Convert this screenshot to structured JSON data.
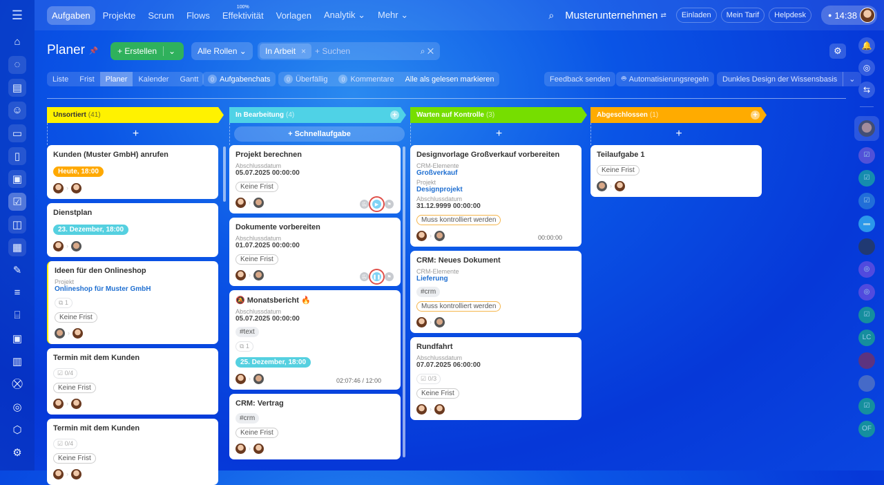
{
  "nav": {
    "items": [
      {
        "label": "Aufgaben",
        "active": true
      },
      {
        "label": "Projekte"
      },
      {
        "label": "Scrum"
      },
      {
        "label": "Flows"
      },
      {
        "label": "Effektivität",
        "sup": "100%"
      },
      {
        "label": "Vorlagen"
      },
      {
        "label": "Analytik ⌄"
      },
      {
        "label": "Mehr ⌄"
      }
    ]
  },
  "header": {
    "company": "Musterunternehmen",
    "invite": "Einladen",
    "tariff": "Mein Tarif",
    "helpdesk": "Helpdesk",
    "time": "14:38"
  },
  "left_sidebar": [
    {
      "icon": "home-icon",
      "g": "⌂"
    },
    {
      "icon": "feed-icon",
      "g": "◌"
    },
    {
      "icon": "docs-icon",
      "g": "▤"
    },
    {
      "icon": "contacts-icon",
      "g": "☺"
    },
    {
      "icon": "drive-icon",
      "g": "▭"
    },
    {
      "icon": "document-icon",
      "g": "▯"
    },
    {
      "icon": "board-icon",
      "g": "▣"
    },
    {
      "icon": "tasks-icon",
      "g": "☑"
    },
    {
      "icon": "chat-icon",
      "g": "◫"
    },
    {
      "icon": "calendar-icon",
      "g": "▦"
    },
    {
      "icon": "sign-icon",
      "g": "✎"
    },
    {
      "icon": "filter-icon",
      "g": "≡"
    },
    {
      "icon": "store-icon",
      "g": "⌸"
    },
    {
      "icon": "contact-center-icon",
      "g": "▣"
    },
    {
      "icon": "analytics-icon",
      "g": "▥"
    },
    {
      "icon": "cart-icon",
      "g": "⛒"
    },
    {
      "icon": "target-icon",
      "g": "◎"
    },
    {
      "icon": "package-icon",
      "g": "⬡"
    },
    {
      "icon": "settings-icon",
      "g": "⚙"
    }
  ],
  "page": {
    "title": "Planer",
    "create": "Erstellen",
    "roles": "Alle Rollen",
    "filter_chip": "In Arbeit",
    "search_placeholder": "+ Suchen"
  },
  "views": [
    "Liste",
    "Frist",
    "Planer",
    "Kalender",
    "Gantt"
  ],
  "counters": {
    "chats_count": "0",
    "chats": "Aufgabenchats",
    "overdue_count": "0",
    "overdue": "Überfällig",
    "comments_count": "0",
    "comments": "Kommentare",
    "mark_read": "Alle als gelesen markieren"
  },
  "actions": {
    "feedback": "Feedback senden",
    "automation": "Automatisierungsregeln",
    "design": "Dunkles Design der Wissensbasis"
  },
  "quick_task": "+ Schnellaufgabe",
  "columns": [
    {
      "title": "Unsortiert",
      "count": "(41)",
      "color": "#fff200",
      "text": "#333",
      "cards": [
        {
          "title": "Kunden (Muster GmbH) anrufen",
          "deadline": "Heute, 18:00",
          "dl_color": "#ffa900",
          "avatars": [
            "f",
            "f"
          ]
        },
        {
          "title": "Dienstplan",
          "deadline": "23. Dezember, 18:00",
          "dl_color": "#55d0e0",
          "avatars": [
            "f",
            "m"
          ]
        },
        {
          "title": "Ideen für den Onlineshop",
          "fields": [
            {
              "label": "Projekt",
              "value": "Onlineshop für Muster GmbH",
              "link": true
            }
          ],
          "counter": "⧉ 1",
          "nofrist": "Keine Frist",
          "avatars": [
            "m",
            "f"
          ]
        },
        {
          "title": "Termin mit dem Kunden",
          "counter": "☑ 0/4",
          "nofrist": "Keine Frist",
          "avatars": [
            "f",
            "f"
          ]
        },
        {
          "title": "Termin mit dem Kunden",
          "counter": "☑ 0/4",
          "nofrist": "Keine Frist",
          "avatars": [
            "f",
            "f"
          ]
        }
      ]
    },
    {
      "title": "In Bearbeitung",
      "count": "(4)",
      "color": "#4fd2e6",
      "text": "#fff",
      "quick": true,
      "plus": true,
      "cards": [
        {
          "title": "Projekt berechnen",
          "fields": [
            {
              "label": "Abschlussdatum",
              "value": "05.07.2025 00:00:00"
            }
          ],
          "nofrist": "Keine Frist",
          "avatars": [
            "f",
            "m"
          ],
          "buttons": "play"
        },
        {
          "title": "Dokumente vorbereiten",
          "fields": [
            {
              "label": "Abschlussdatum",
              "value": "01.07.2025 00:00:00"
            }
          ],
          "nofrist": "Keine Frist",
          "avatars": [
            "f",
            "m"
          ],
          "buttons": "pause"
        },
        {
          "title": "🔕 Monatsbericht 🔥",
          "fields": [
            {
              "label": "Abschlussdatum",
              "value": "05.07.2025 00:00:00"
            }
          ],
          "tag": "#text",
          "counter": "⧉ 1",
          "deadline": "25. Dezember, 18:00",
          "dl_color": "#55d0e0",
          "avatars": [
            "f",
            "m"
          ],
          "timer": "02:07:46 / 12:00"
        },
        {
          "title": "CRM: Vertrag",
          "tag": "#crm",
          "nofrist": "Keine Frist",
          "avatars": [
            "f",
            "f"
          ]
        }
      ]
    },
    {
      "title": "Warten auf Kontrolle",
      "count": "(3)",
      "color": "#76de00",
      "text": "#fff",
      "cards": [
        {
          "title": "Designvorlage Großverkauf vorbereiten",
          "fields": [
            {
              "label": "CRM-Elemente",
              "value": "Großverkauf",
              "link": true
            },
            {
              "label": "Projekt",
              "value": "Designprojekt",
              "link": true
            },
            {
              "label": "Abschlussdatum",
              "value": "31.12.9999 00:00:00"
            }
          ],
          "check": "Muss kontrolliert werden",
          "avatars": [
            "f",
            "m"
          ],
          "timer": "00:00:00"
        },
        {
          "title": "CRM: Neues Dokument",
          "fields": [
            {
              "label": "CRM-Elemente",
              "value": "Lieferung",
              "link": true
            }
          ],
          "tag": "#crm",
          "check": "Muss kontrolliert werden",
          "avatars": [
            "f",
            "m"
          ]
        },
        {
          "title": "Rundfahrt",
          "fields": [
            {
              "label": "Abschlussdatum",
              "value": "07.07.2025 06:00:00"
            }
          ],
          "counter": "☑ 0/3",
          "nofrist": "Keine Frist",
          "avatars": [
            "f",
            "f"
          ]
        }
      ]
    },
    {
      "title": "Abgeschlossen",
      "count": "(1)",
      "color": "#ffab00",
      "text": "#fff",
      "plus": true,
      "cards": [
        {
          "title": "Teilaufgabe 1",
          "nofrist": "Keine Frist",
          "avatars": [
            "m",
            "f"
          ]
        }
      ]
    }
  ],
  "right_sidebar": [
    {
      "icon": "bell-icon",
      "g": "🔔"
    },
    {
      "icon": "copilot-icon",
      "g": "◎"
    },
    {
      "icon": "messenger-icon",
      "g": "⇆"
    }
  ],
  "recent_chats": [
    {
      "icon": "avatar",
      "bg": "#c9a58a"
    },
    {
      "icon": "task-chat-icon",
      "bg": "#6a5ad8",
      "g": "☑"
    },
    {
      "icon": "task-chat-icon",
      "bg": "#1aa9a0",
      "g": "☑"
    },
    {
      "icon": "task-chat-icon",
      "bg": "#2a80d8",
      "g": "☑"
    },
    {
      "icon": "chat-bubble-icon",
      "bg": "#38b8f0",
      "g": "▬"
    },
    {
      "icon": "avatar",
      "bg": "#2a3a50"
    },
    {
      "icon": "copilot-icon",
      "bg": "#6a50e0",
      "g": "◎"
    },
    {
      "icon": "copilot-icon",
      "bg": "#6a50e0",
      "g": "◎"
    },
    {
      "icon": "task-chat-icon",
      "bg": "#1aa98a",
      "g": "☑"
    },
    {
      "icon": "group-initials",
      "bg": "#1aa98a",
      "g": "LC"
    },
    {
      "icon": "avatar",
      "bg": "#7a3060"
    },
    {
      "icon": "group-avatar",
      "bg": "#5a78c0"
    },
    {
      "icon": "task-chat-icon",
      "bg": "#1aa98a",
      "g": "☑"
    },
    {
      "icon": "group-initials",
      "bg": "#1aa98a",
      "g": "OF"
    }
  ]
}
